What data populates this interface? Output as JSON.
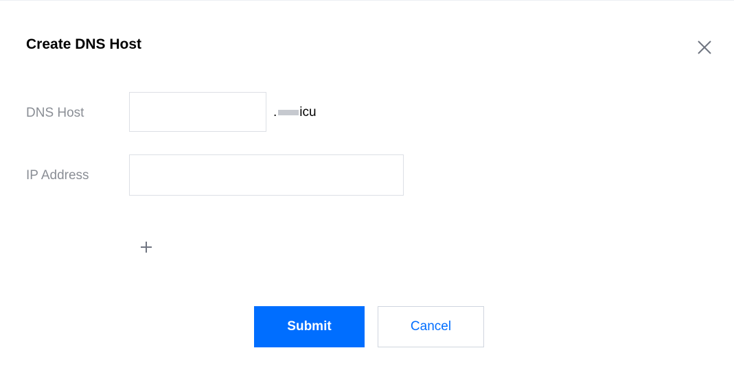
{
  "dialog": {
    "title": "Create DNS Host",
    "close_icon": "close-icon"
  },
  "form": {
    "dns_host": {
      "label": "DNS Host",
      "value": "",
      "placeholder": "",
      "suffix_prefix": ".",
      "suffix_tld": "icu"
    },
    "ip_address": {
      "label": "IP Address",
      "value": "",
      "placeholder": ""
    },
    "add_icon": "plus-icon"
  },
  "actions": {
    "submit_label": "Submit",
    "cancel_label": "Cancel"
  },
  "colors": {
    "primary": "#006eff",
    "label": "#8a8e95",
    "input_border": "#dcdfe5",
    "icon": "#6f7480"
  }
}
